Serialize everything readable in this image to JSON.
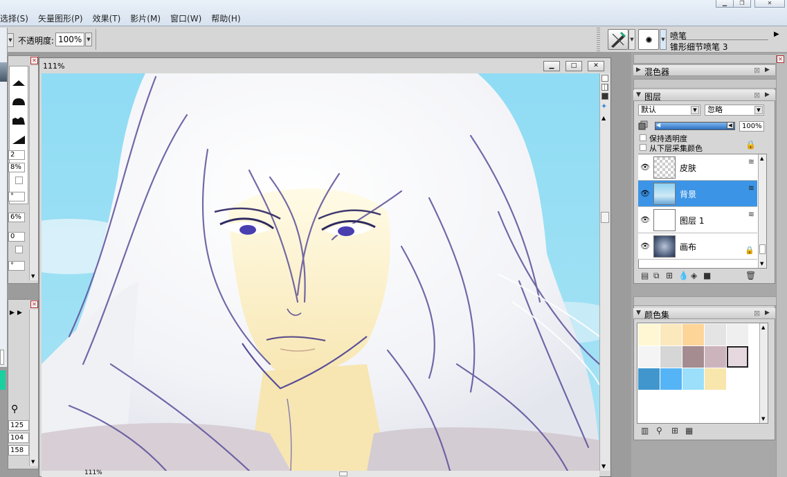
{
  "menubar": {
    "items": [
      "选择(S)",
      "矢量图形(P)",
      "效果(T)",
      "影片(M)",
      "窗口(W)",
      "帮助(H)"
    ],
    "window_controls": [
      "minimize",
      "restore",
      "close"
    ]
  },
  "options": {
    "opacity_label": "不透明度:",
    "opacity_value": "100%",
    "brush_category": "喷笔",
    "brush_variant": "锥形细节喷笔 3"
  },
  "left_panel": {
    "fields": [
      "2",
      "8%",
      "°",
      "6%",
      "0",
      "°"
    ],
    "rgb": [
      "125",
      "104",
      "158"
    ]
  },
  "canvas": {
    "zoom": "111%",
    "bottom_zoom": "111%"
  },
  "panels": {
    "mixer": {
      "title": "混色器"
    },
    "layers": {
      "title": "图层",
      "composite_method": "默认",
      "depth_mode": "忽略",
      "opacity": "100%",
      "preserve_transparency": "保持透明度",
      "pick_up_underlying": "从下层采集颜色",
      "items": [
        {
          "name": "皮肤",
          "visible": true,
          "selected": false
        },
        {
          "name": "背景",
          "visible": true,
          "selected": true
        },
        {
          "name": "图层 1",
          "visible": true,
          "selected": false
        },
        {
          "name": "画布",
          "visible": true,
          "selected": false
        }
      ]
    },
    "color_set": {
      "title": "颜色集",
      "swatches": [
        "#fff7d4",
        "#fbe8bd",
        "#fdd598",
        "#e4e4e4",
        "#efefef",
        "#f4f4f4",
        "#d6d6d6",
        "#a48c90",
        "#ccb4bd",
        "#e6d8df",
        "#4196cd",
        "#55b4f5",
        "#9bdffb",
        "#f8e6ad"
      ]
    }
  },
  "colors": {
    "menubar_bg": "#dfe8f3",
    "panel_bg": "#d6d6d6",
    "selection_blue": "#3c94e6",
    "sky": "#8fd8f2"
  }
}
